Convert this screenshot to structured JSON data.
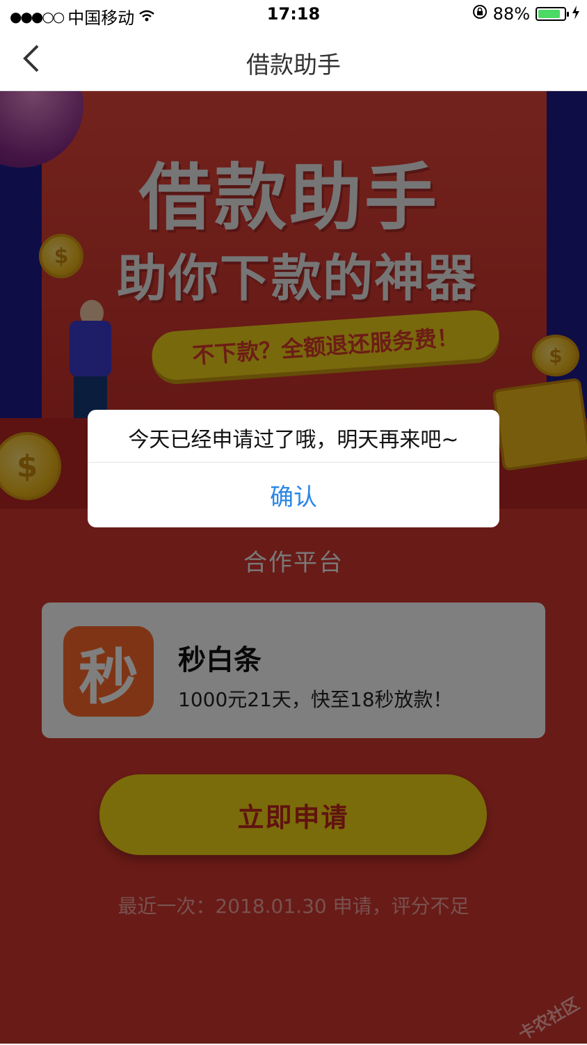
{
  "status_bar": {
    "signal": "●●●○○",
    "carrier": "中国移动",
    "time": "17:18",
    "battery_percent": "88%",
    "battery_level": 0.88
  },
  "nav": {
    "title": "借款助手",
    "back_icon": "chevron-left-icon"
  },
  "banner": {
    "headline": "借款助手",
    "subheadline": "助你下款的神器",
    "pill_text": "不下款？全额退还服务费！",
    "coin_symbol": "$"
  },
  "partners": {
    "section_title": "合作平台",
    "card": {
      "icon_char": "秒",
      "name": "秒白条",
      "description": "1000元21天，快至18秒放款！"
    }
  },
  "apply_button_label": "立即申请",
  "recent_text": "最近一次：2018.01.30 申请，评分不足",
  "watermark": "卡农社区",
  "dialog": {
    "message": "今天已经申请过了哦，明天再来吧~",
    "confirm_label": "确认"
  },
  "colors": {
    "page_red": "#d2362e",
    "accent_yellow": "#f5d814",
    "dialog_button_blue": "#2a86e6",
    "app_icon_orange": "#ff6b2b"
  }
}
